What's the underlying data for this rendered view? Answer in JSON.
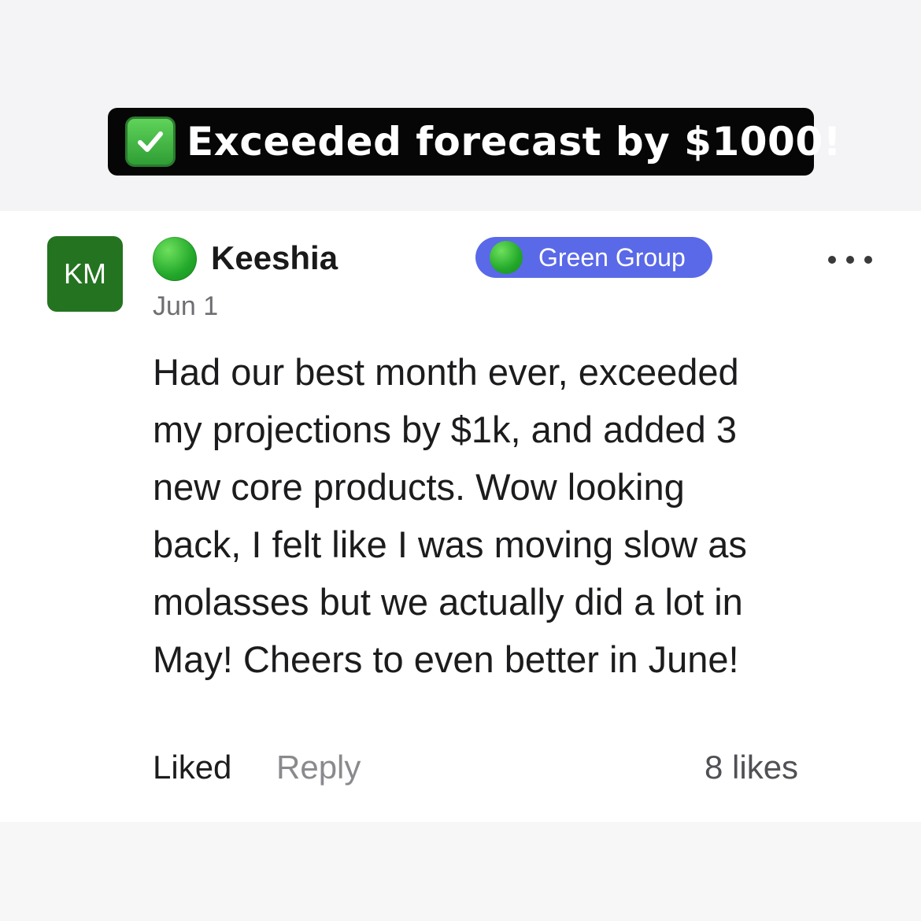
{
  "banner": {
    "icon": "check-mark-button-icon",
    "text": "Exceeded forecast by $1000!"
  },
  "post": {
    "avatar_initials": "KM",
    "status_icon": "green-circle-icon",
    "author": "Keeshia",
    "group": {
      "icon": "green-circle-icon",
      "label": "Green Group",
      "color": "#5a69e8"
    },
    "more_icon": "more-options-icon",
    "date": "Jun 1",
    "body_lines": [
      "Had our best month ever, exceeded",
      "my projections by $1k, and added 3",
      "new core products. Wow looking",
      "back, I felt like I was moving slow as",
      "molasses but we actually did a lot in",
      "May! Cheers to even better in June!"
    ],
    "actions": {
      "liked_label": "Liked",
      "reply_label": "Reply",
      "likes_count": "8 likes"
    }
  },
  "colors": {
    "avatar": "#247320",
    "banner_bg": "#060606",
    "status_green": "#22a82a"
  }
}
